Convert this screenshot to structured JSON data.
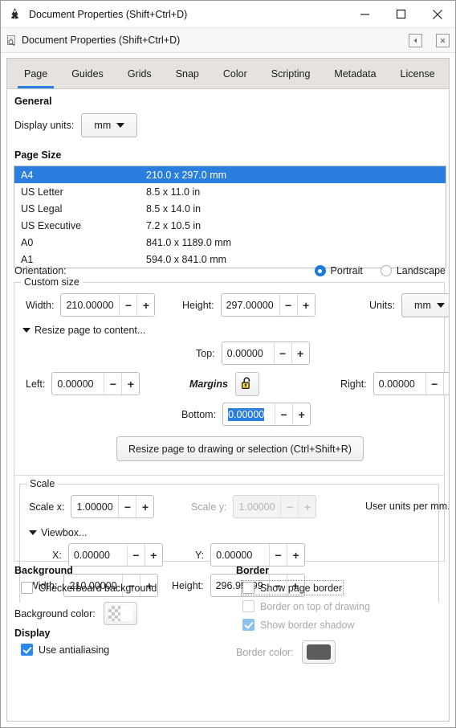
{
  "window": {
    "title": "Document Properties (Shift+Ctrl+D)",
    "icon": "inkscape-logo-icon",
    "minimize_label": "—",
    "maximize_label": "□",
    "close_label": "✕"
  },
  "dock": {
    "title": "Document Properties (Shift+Ctrl+D)",
    "icon": "document-search-icon",
    "collapse_label": "◀",
    "close_label": "✖"
  },
  "tabs": [
    {
      "label": "Page",
      "active": true
    },
    {
      "label": "Guides",
      "active": false
    },
    {
      "label": "Grids",
      "active": false
    },
    {
      "label": "Snap",
      "active": false
    },
    {
      "label": "Color",
      "active": false
    },
    {
      "label": "Scripting",
      "active": false
    },
    {
      "label": "Metadata",
      "active": false
    },
    {
      "label": "License",
      "active": false
    }
  ],
  "general": {
    "heading": "General",
    "display_units_label": "Display units:",
    "display_units_value": "mm"
  },
  "page_size": {
    "heading": "Page Size",
    "items": [
      {
        "name": "A4",
        "dimensions": "210.0 x 297.0 mm",
        "selected": true
      },
      {
        "name": "US Letter",
        "dimensions": "8.5 x 11.0 in",
        "selected": false
      },
      {
        "name": "US Legal",
        "dimensions": "8.5 x 14.0 in",
        "selected": false
      },
      {
        "name": "US Executive",
        "dimensions": "7.2 x 10.5 in",
        "selected": false
      },
      {
        "name": "A0",
        "dimensions": "841.0 x 1189.0 mm",
        "selected": false
      },
      {
        "name": "A1",
        "dimensions": "594.0 x 841.0 mm",
        "selected": false
      }
    ]
  },
  "orientation": {
    "label": "Orientation:",
    "portrait_label": "Portrait",
    "landscape_label": "Landscape",
    "selected": "Portrait"
  },
  "custom_size": {
    "legend": "Custom size",
    "width_label": "Width:",
    "width_value": "210.00000",
    "height_label": "Height:",
    "height_value": "297.00000",
    "units_label": "Units:",
    "units_value": "mm",
    "resize_to_content_label": "Resize page to content...",
    "margins_label": "Margins",
    "margins_lock_icon": "padlock-open-icon",
    "top_label": "Top:",
    "top_value": "0.00000",
    "left_label": "Left:",
    "left_value": "0.00000",
    "right_label": "Right:",
    "right_value": "0.00000",
    "bottom_label": "Bottom:",
    "bottom_value": "0.00000",
    "resize_button_label": "Resize page to drawing or selection (Ctrl+Shift+R)"
  },
  "scale": {
    "legend": "Scale",
    "scale_x_label": "Scale x:",
    "scale_x_value": "1.00000",
    "scale_y_label": "Scale y:",
    "scale_y_value": "1.00000",
    "units_note": "User units per mm.",
    "viewbox_label": "Viewbox...",
    "x_label": "X:",
    "x_value": "0.00000",
    "y_label": "Y:",
    "y_value": "0.00000",
    "width_label": "Width:",
    "width_value": "210.00000",
    "height_label": "Height:",
    "height_value": "296.99999"
  },
  "background": {
    "heading": "Background",
    "checkerboard_label": "Checkerboard background",
    "checkerboard_checked": false,
    "color_label": "Background color:",
    "color_swatch": "transparent-white"
  },
  "display": {
    "heading": "Display",
    "antialias_label": "Use antialiasing",
    "antialias_checked": true
  },
  "border": {
    "heading": "Border",
    "show_page_border_label": "Show page border",
    "show_page_border_checked": false,
    "border_on_top_label": "Border on top of drawing",
    "border_on_top_checked": false,
    "show_shadow_label": "Show border shadow",
    "show_shadow_checked": true,
    "color_label": "Border color:",
    "color_swatch": "#5b5b5b"
  },
  "colors": {
    "accent": "#2a7fde",
    "selection": "#2a7fde",
    "tab_bar": "#e6e3de",
    "checkbox_on": "#2a88e8"
  }
}
